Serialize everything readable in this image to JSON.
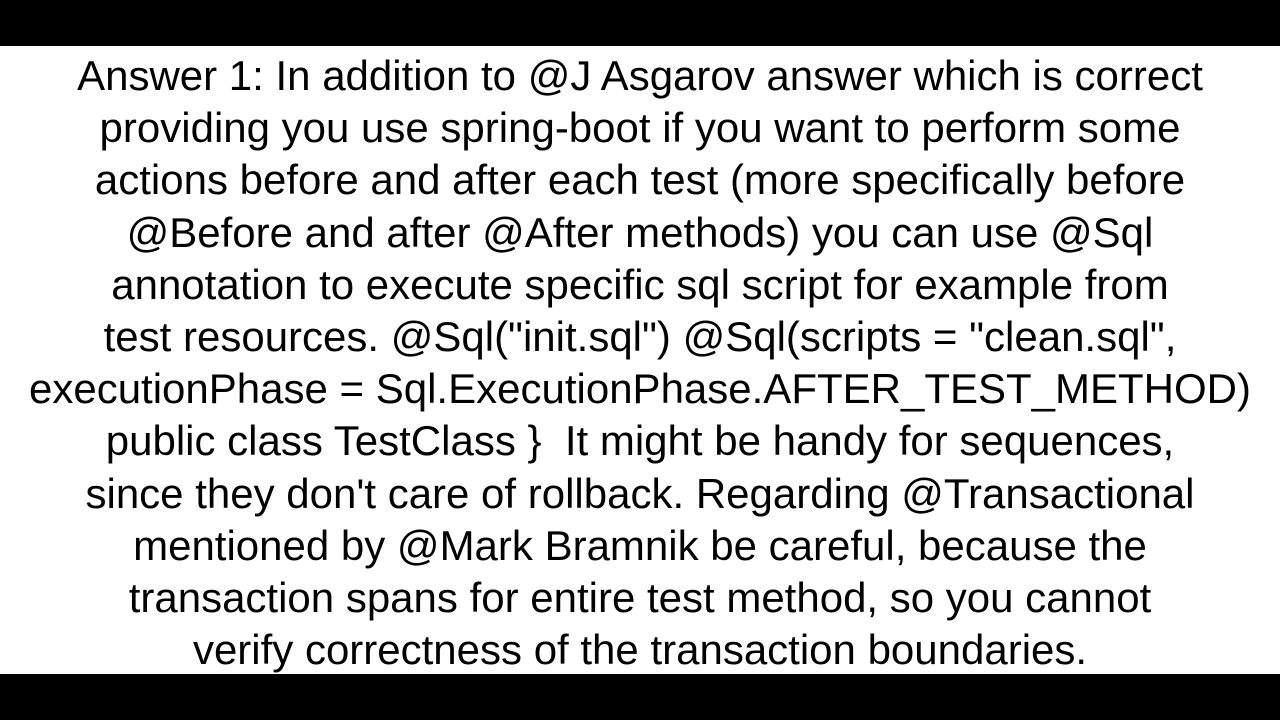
{
  "colors": {
    "background": "#ffffff",
    "text": "#000000",
    "letterbox": "#000000"
  },
  "answer": {
    "lines": [
      "Answer 1: In addition to @J Asgarov answer which is correct",
      "providing you use spring-boot if you want to perform some",
      "actions before and after each test (more specifically before",
      "@Before and after @After methods) you can use @Sql",
      "annotation to execute specific sql script for example from",
      "test resources. @Sql(\"init.sql\") @Sql(scripts = \"clean.sql\",",
      "executionPhase = Sql.ExecutionPhase.AFTER_TEST_METHOD)",
      "public class TestClass }  It might be handy for sequences,",
      "since they don't care of rollback. Regarding @Transactional",
      "mentioned by @Mark Bramnik be careful, because the",
      "transaction spans for entire test method, so you cannot",
      "verify correctness of the transaction boundaries."
    ]
  }
}
